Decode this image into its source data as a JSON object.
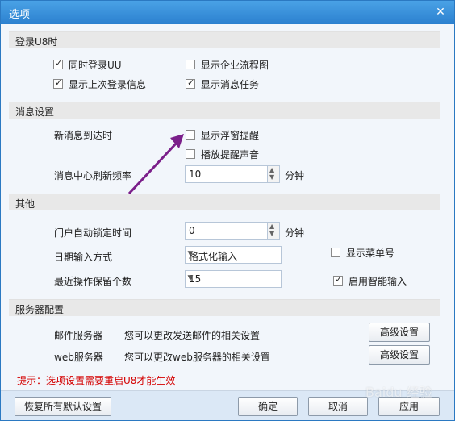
{
  "window": {
    "title": "选项"
  },
  "sections": {
    "login": "登录U8时",
    "message": "消息设置",
    "other": "其他",
    "server": "服务器配置"
  },
  "login": {
    "cb_login_uu": "同时登录UU",
    "cb_show_last_login": "显示上次登录信息",
    "cb_show_enterprise_flow": "显示企业流程图",
    "cb_show_message_tasks": "显示消息任务"
  },
  "message": {
    "arrival_label": "新消息到达时",
    "cb_show_float": "显示浮窗提醒",
    "cb_play_sound": "播放提醒声音",
    "refresh_label": "消息中心刷新频率",
    "refresh_value": "10",
    "refresh_unit": "分钟"
  },
  "other": {
    "lock_label": "门户自动锁定时间",
    "lock_value": "0",
    "lock_unit": "分钟",
    "date_label": "日期输入方式",
    "date_value": "格式化输入",
    "recent_label": "最近操作保留个数",
    "recent_value": "15",
    "cb_show_menu_no": "显示菜单号",
    "cb_smart_input": "启用智能输入"
  },
  "server": {
    "mail_label": "邮件服务器",
    "mail_desc": "您可以更改发送邮件的相关设置",
    "mail_button": "高级设置",
    "web_label": "web服务器",
    "web_desc": "您可以更改web服务器的相关设置",
    "web_button": "高级设置"
  },
  "hint": "提示：选项设置需要重启U8才能生效",
  "buttons": {
    "restore": "恢复所有默认设置",
    "ok": "确定",
    "cancel": "取消",
    "apply": "应用"
  },
  "watermark": "Baidu 经验",
  "colors": {
    "titlebar": "#2b80cf",
    "hint": "#d40000",
    "annotation_arrow": "#7b1f8a"
  }
}
